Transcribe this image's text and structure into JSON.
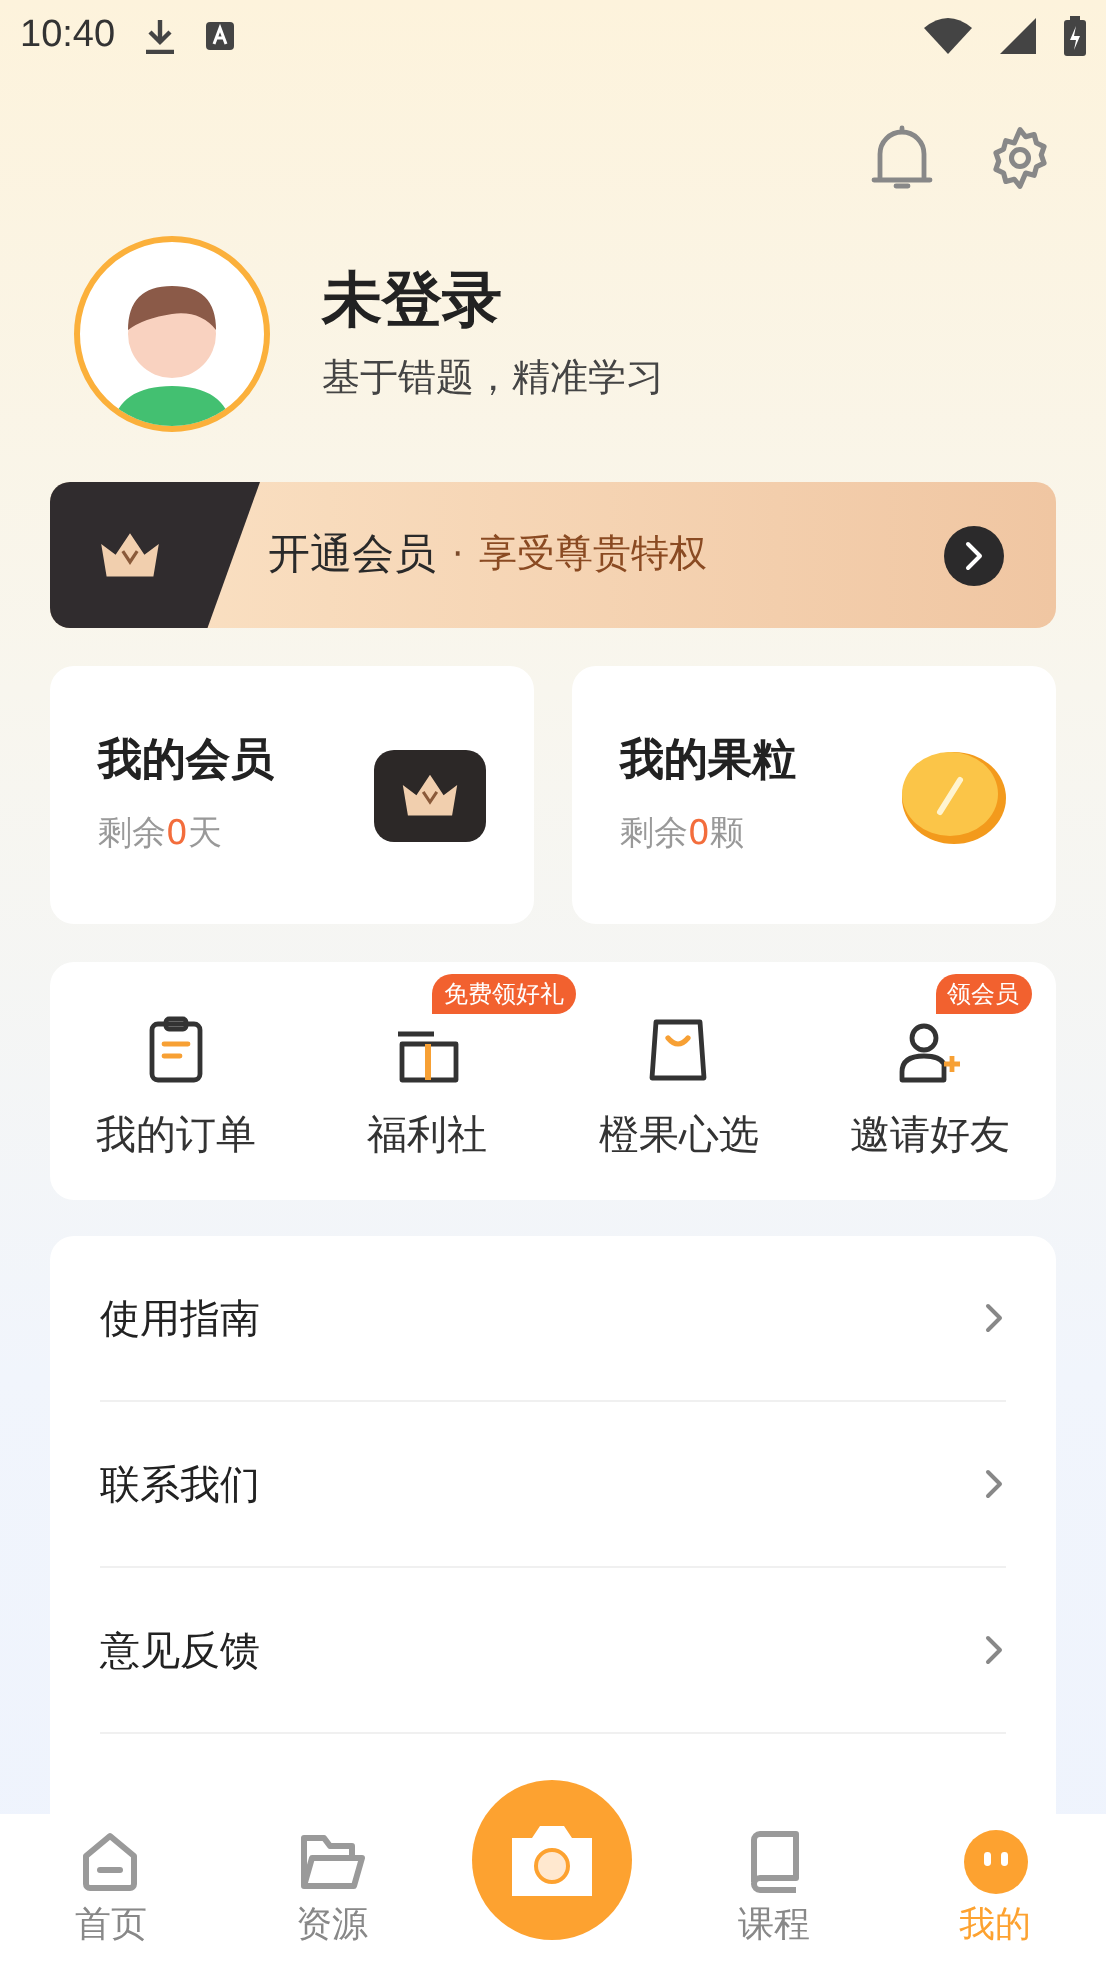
{
  "status_bar": {
    "time": "10:40"
  },
  "profile": {
    "name": "未登录",
    "subtitle": "基于错题，精准学习"
  },
  "vip_banner": {
    "title": "开通会员",
    "separator": "·",
    "subtitle": "享受尊贵特权"
  },
  "cards": [
    {
      "kind": "vip",
      "title": "我的会员",
      "prefix": "剩余",
      "count": "0",
      "unit": "天"
    },
    {
      "kind": "coin",
      "title": "我的果粒",
      "prefix": "剩余",
      "count": "0",
      "unit": "颗"
    }
  ],
  "shortcuts": [
    {
      "kind": "order",
      "label": "我的订单"
    },
    {
      "kind": "gift",
      "label": "福利社",
      "badge": "免费领好礼"
    },
    {
      "kind": "bag",
      "label": "橙果心选"
    },
    {
      "kind": "invite",
      "label": "邀请好友",
      "badge": "领会员"
    }
  ],
  "menu": [
    {
      "label": "使用指南"
    },
    {
      "label": "联系我们"
    },
    {
      "label": "意见反馈"
    }
  ],
  "tab_bar": [
    {
      "kind": "home",
      "label": "首页",
      "selected": false
    },
    {
      "kind": "folder",
      "label": "资源",
      "selected": false
    },
    {
      "kind": "camera"
    },
    {
      "kind": "book",
      "label": "课程",
      "selected": false
    },
    {
      "kind": "me",
      "label": "我的",
      "selected": true
    }
  ]
}
